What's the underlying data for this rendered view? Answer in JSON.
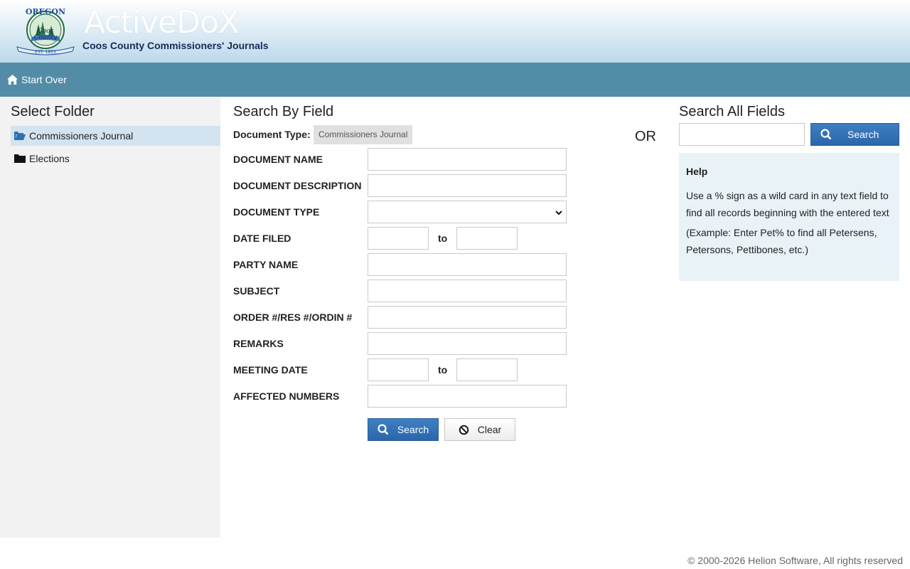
{
  "header": {
    "brand": "ActiveDoX",
    "subtitle": "Coos County Commissioners' Journals",
    "seal": {
      "top_text": "OREGON",
      "line1": "Coos",
      "line2": "County",
      "est": "EST. 1853"
    }
  },
  "nav": {
    "start_over": "Start Over"
  },
  "sidebar": {
    "title": "Select Folder",
    "folders": [
      {
        "label": "Commissioners Journal",
        "active": true,
        "icon": "folder-open-icon"
      },
      {
        "label": "Elections",
        "active": false,
        "icon": "folder-icon"
      }
    ]
  },
  "search_by_field": {
    "title": "Search By Field",
    "doc_type_label": "Document Type:",
    "doc_type_value": "Commissioners Journal",
    "fields": {
      "document_name": "DOCUMENT NAME",
      "document_description": "DOCUMENT DESCRIPTION",
      "document_type": "DOCUMENT TYPE",
      "date_filed": "DATE FILED",
      "party_name": "PARTY NAME",
      "subject": "SUBJECT",
      "order_res_ordin": "ORDER #/RES #/ORDIN #",
      "remarks": "REMARKS",
      "meeting_date": "MEETING DATE",
      "affected_numbers": "AFFECTED NUMBERS"
    },
    "to_label": "to",
    "search_button": "Search",
    "clear_button": "Clear"
  },
  "or_label": "OR",
  "search_all": {
    "title": "Search All Fields",
    "search_button": "Search",
    "help_title": "Help",
    "help_text1": "Use a % sign as a wild card in any text field to find all records beginning with the entered text",
    "help_text2": "(Example: Enter Pet% to find all Petersens, Petersons, Pettibones, etc.)"
  },
  "footer": "© 2000-2026 Helion Software, All rights reserved",
  "colors": {
    "nav": "#538ca7",
    "primary_button": "#2f6fb5",
    "sidebar_active": "#d3e3ef",
    "help_bg": "#e9f2f7"
  }
}
